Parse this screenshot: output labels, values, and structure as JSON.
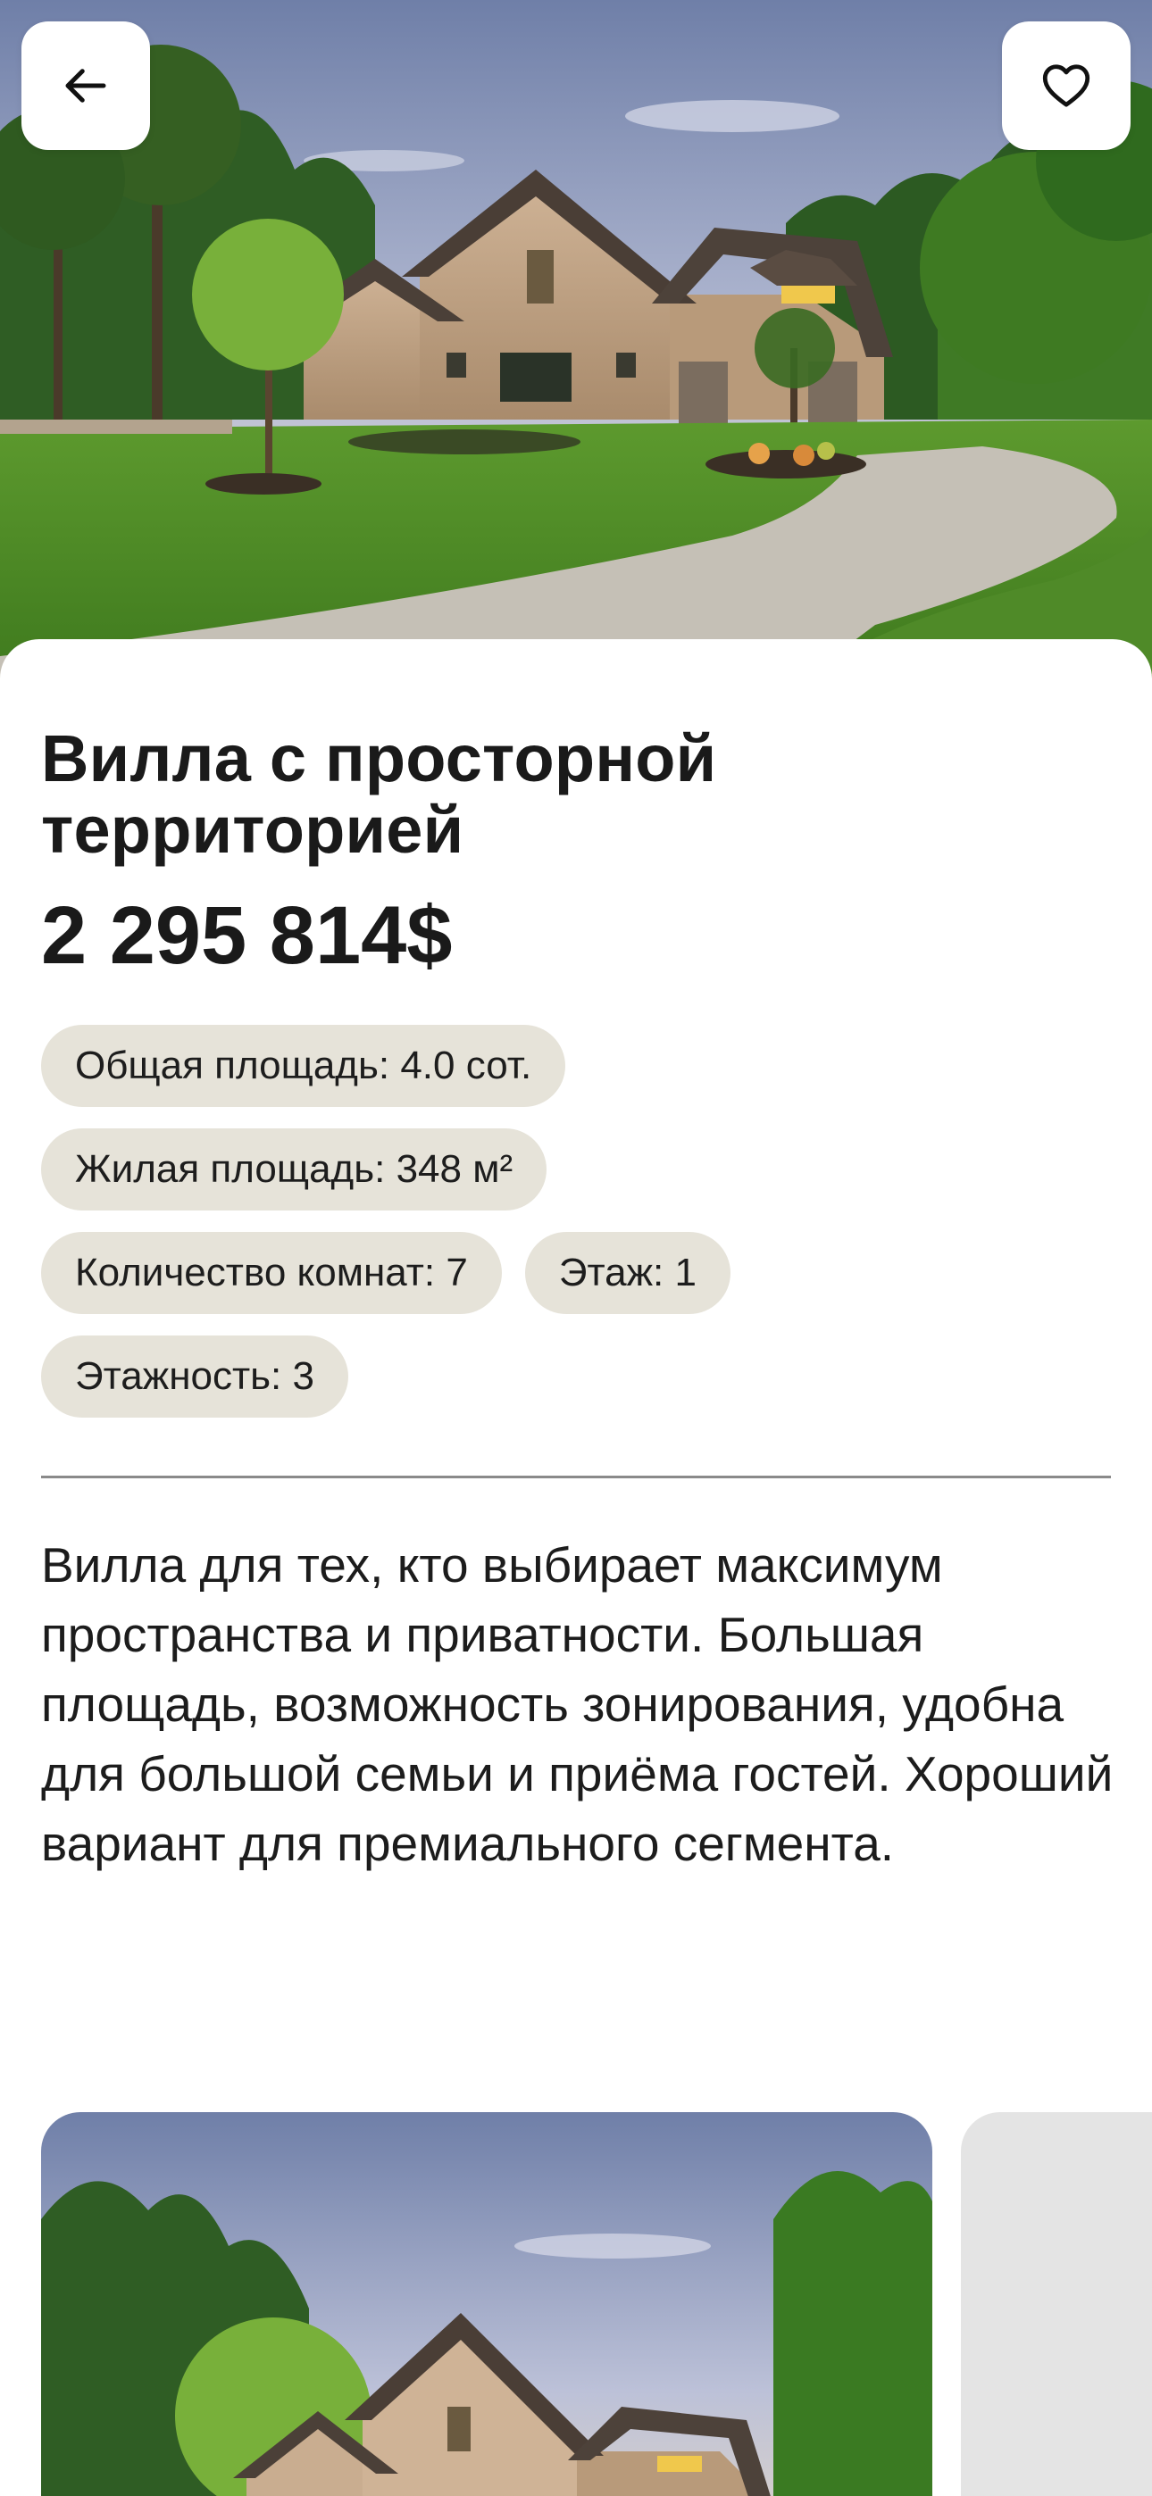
{
  "hero": {
    "image": "villa-photo",
    "back_icon": "arrow-left-icon",
    "favorite_icon": "heart-icon"
  },
  "listing": {
    "title": "Вилла с просторной территорией",
    "price": "2 295 814$",
    "chips": [
      "Общая площадь: 4.0 сот.",
      "Жилая площадь: 348 м²",
      "Количество комнат: 7",
      "Этаж: 1",
      "Этажность: 3"
    ],
    "description": "Вилла для тех, кто выбирает максимум пространства и приватности. Большая площадь, возможность зонирования, удобна для большой семьи и приёма гостей. Хороший вариант для премиального сегмента."
  },
  "colors": {
    "chip_bg": "#e6e3d9",
    "text": "#1a1a1a",
    "divider": "#8a8a8a"
  }
}
